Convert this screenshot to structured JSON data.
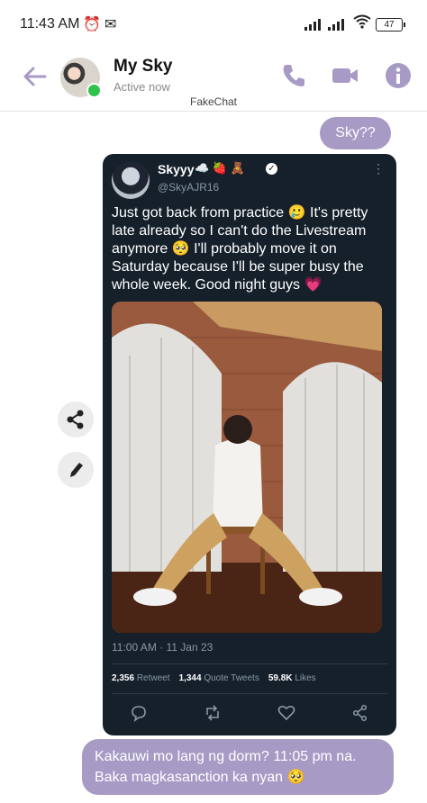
{
  "status": {
    "time": "11:43 AM",
    "battery": "47"
  },
  "header": {
    "name": "My Sky",
    "status": "Active now",
    "watermark": "FakeChat"
  },
  "messages": {
    "first": "Sky??",
    "second": "Kakauwi mo lang ng dorm? 11:05 pm na. Baka magkasanction ka nyan 🥺"
  },
  "tweet": {
    "name": "Skyyy",
    "name_emojis": "☁️ 🍓 🧸",
    "handle": "@SkyAJR16",
    "text": "Just got back from practice 🥲 It's pretty late already so I can't do the Livestream anymore 🥺 I'll probably move it on Saturday because I'll be super busy the whole week. Good night guys 💗",
    "time": "11:00 AM · 11 Jan 23",
    "retweets": "2,356",
    "retweets_label": "Retweet",
    "quotes": "1,344",
    "quotes_label": "Quote Tweets",
    "likes": "59.8K",
    "likes_label": "Likes"
  },
  "colors": {
    "accent": "#a79bc6",
    "tweet_bg": "#15202b",
    "online": "#31c24d"
  }
}
